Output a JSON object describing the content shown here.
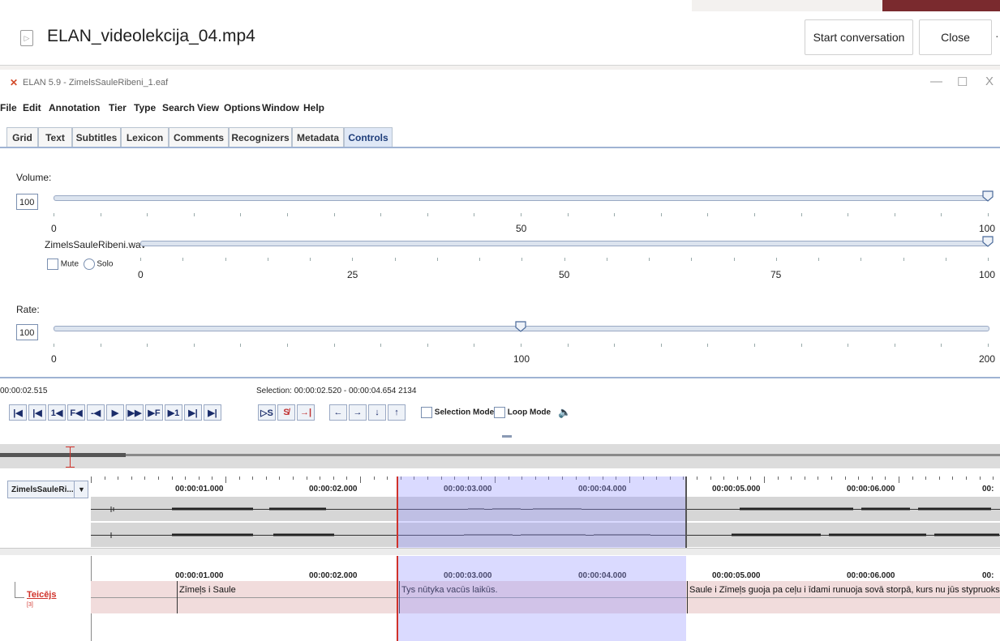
{
  "viewer": {
    "file_icon": "play-file-icon",
    "file_title": "ELAN_videolekcija_04.mp4",
    "start_conversation": "Start conversation",
    "close": "Close",
    "more": "·"
  },
  "elan": {
    "app_icon": "elan-logo-icon",
    "window_title": "ELAN 5.9 - ZimelsSauleRibeni_1.eaf",
    "window_controls": [
      "—",
      "☐",
      "X"
    ],
    "menu": [
      "File",
      "Edit",
      "Annotation",
      "Tier",
      "Type",
      "Search",
      "View",
      "Options",
      "Window",
      "Help"
    ],
    "tabs": [
      "Grid",
      "Text",
      "Subtitles",
      "Lexicon",
      "Comments",
      "Recognizers",
      "Metadata",
      "Controls"
    ],
    "active_tab": "Controls",
    "volume": {
      "label": "Volume:",
      "value": "100",
      "level": 1.0,
      "scale": [
        "0",
        "50",
        "100"
      ]
    },
    "track": {
      "name": "ZimelsSauleRibeni.wav",
      "mute_label": "Mute",
      "solo_label": "Solo",
      "level": 1.0,
      "scale": [
        "0",
        "25",
        "50",
        "75",
        "100"
      ]
    },
    "rate": {
      "label": "Rate:",
      "value": "100",
      "level": 0.5,
      "scale": [
        "0",
        "100",
        "200"
      ]
    },
    "current_time": "00:00:02.515",
    "selection_text": "Selection: 00:00:02.520 - 00:00:04.654  2134",
    "player_buttons": [
      "|◀",
      "|◀",
      "1◀",
      "F◀",
      "-◀",
      "▶",
      "▶▶",
      "▶F",
      "▶1",
      "▶|",
      "▶|"
    ],
    "selection_buttons": [
      "▷S",
      "S̸",
      "→|"
    ],
    "nav_buttons": [
      "←",
      "→",
      "↓",
      "↑"
    ],
    "selection_mode": "Selection Mode",
    "loop_mode": "Loop Mode",
    "speaker_icon": "speaker-icon",
    "waveform_tier": "ZimelsSauleRi...",
    "time_ticks": [
      "00:00:01.000",
      "00:00:02.000",
      "00:00:03.000",
      "00:00:04.000",
      "00:00:05.000",
      "00:00:06.000",
      "00:"
    ],
    "annotation_tier": "Teicējs",
    "annotation_tier_count": "[3]",
    "annotations": [
      "Zīmeļs i Saule",
      "Tys nūtyka vacūs laikūs.",
      "Saule i Zīmeļs guoja pa ceļu i īdami runuoja sovā storpā, kurs nu jūs stypruoks."
    ]
  }
}
